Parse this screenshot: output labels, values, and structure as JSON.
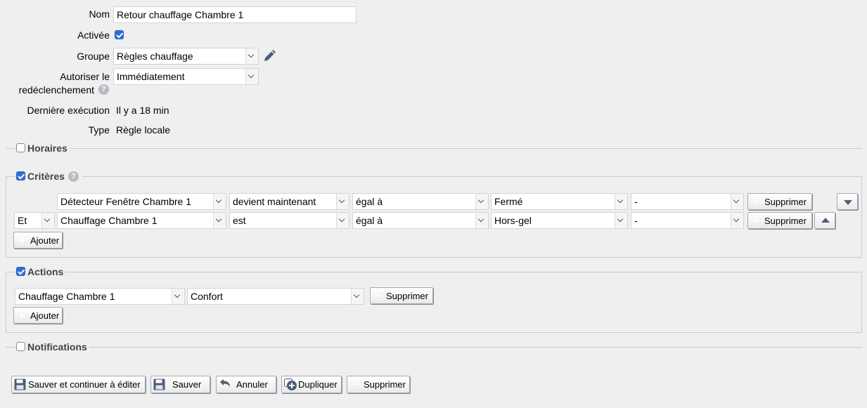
{
  "form": {
    "name_label": "Nom",
    "name_value": "Retour chauffage Chambre 1",
    "enabled_label": "Activée",
    "group_label": "Groupe",
    "group_value": "Règles chauffage",
    "retrigger_label_line1": "Autoriser le",
    "retrigger_label_line2": "redéclenchement",
    "retrigger_value": "Immédiatement",
    "last_exec_label": "Dernière exécution",
    "last_exec_value": "Il y a 18 min",
    "type_label": "Type",
    "type_value": "Règle locale"
  },
  "sections": {
    "schedules": "Horaires",
    "criteria": "Critères",
    "actions": "Actions",
    "notifications": "Notifications"
  },
  "criteria": [
    {
      "device": "Détecteur Fenêtre Chambre 1",
      "event": "devient maintenant",
      "comparator": "égal à",
      "value": "Fermé",
      "extra": "-",
      "delete_label": "Supprimer"
    },
    {
      "connector": "Et",
      "device": "Chauffage Chambre 1",
      "event": "est",
      "comparator": "égal à",
      "value": "Hors-gel",
      "extra": "-",
      "delete_label": "Supprimer"
    }
  ],
  "criteria_add_label": "Ajouter",
  "actions": [
    {
      "device": "Chauffage Chambre 1",
      "value": "Confort",
      "delete_label": "Supprimer"
    }
  ],
  "actions_add_label": "Ajouter",
  "footer": {
    "save_continue": "Sauver et continuer à éditer",
    "save": "Sauver",
    "cancel": "Annuler",
    "duplicate": "Dupliquer",
    "delete": "Supprimer"
  },
  "colors": {
    "checkbox_on": "#2f6fd6",
    "icon_dark": "#4c5d76",
    "background": "#efefef"
  }
}
